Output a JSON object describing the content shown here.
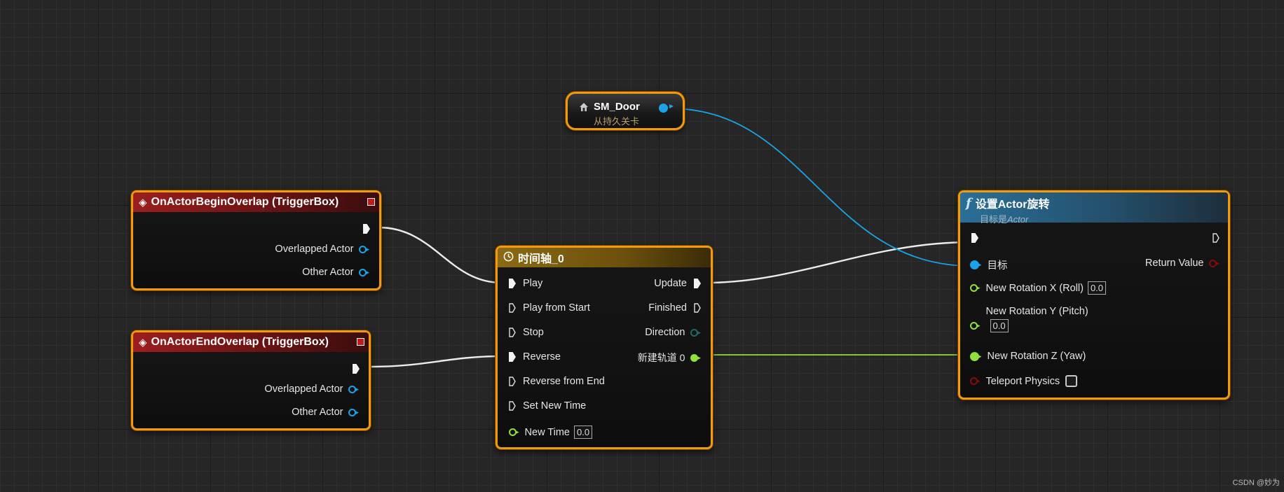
{
  "colors": {
    "selection_border": "#f09a0f",
    "event_header": "#9c1e1e",
    "timeline_header": "#8a6a14",
    "function_header": "#2a6f97",
    "object_pin": "#1aa3e8",
    "float_pin": "#8fe03a",
    "bool_pin": "#8a0a0a",
    "exec_wire": "#ececec"
  },
  "sm_door": {
    "icon": "actor-reference-icon",
    "title": "SM_Door",
    "subtitle": "从持久关卡"
  },
  "begin_overlap": {
    "icon": "event-diamond-icon",
    "title": "OnActorBeginOverlap (TriggerBox)",
    "pins": {
      "overlapped": "Overlapped Actor",
      "other": "Other Actor"
    }
  },
  "end_overlap": {
    "icon": "event-diamond-icon",
    "title": "OnActorEndOverlap (TriggerBox)",
    "pins": {
      "overlapped": "Overlapped Actor",
      "other": "Other Actor"
    }
  },
  "timeline": {
    "icon": "clock-icon",
    "title": "时间轴_0",
    "inputs": {
      "play": "Play",
      "play_from_start": "Play from Start",
      "stop": "Stop",
      "reverse": "Reverse",
      "reverse_from_end": "Reverse from End",
      "set_new_time": "Set New Time",
      "new_time": "New Time",
      "new_time_value": "0.0"
    },
    "outputs": {
      "update": "Update",
      "finished": "Finished",
      "direction": "Direction",
      "track": "新建轨道 0"
    }
  },
  "set_rotation": {
    "icon": "function-f-icon",
    "title": "设置Actor旋转",
    "subtitle_prefix": "目标是",
    "subtitle_target": "Actor",
    "pins": {
      "target": "目标",
      "return_value": "Return Value",
      "roll": "New Rotation X (Roll)",
      "roll_value": "0.0",
      "pitch": "New Rotation Y (Pitch)",
      "pitch_value": "0.0",
      "yaw": "New Rotation Z (Yaw)",
      "teleport": "Teleport Physics"
    }
  },
  "watermark": "CSDN @妙为"
}
